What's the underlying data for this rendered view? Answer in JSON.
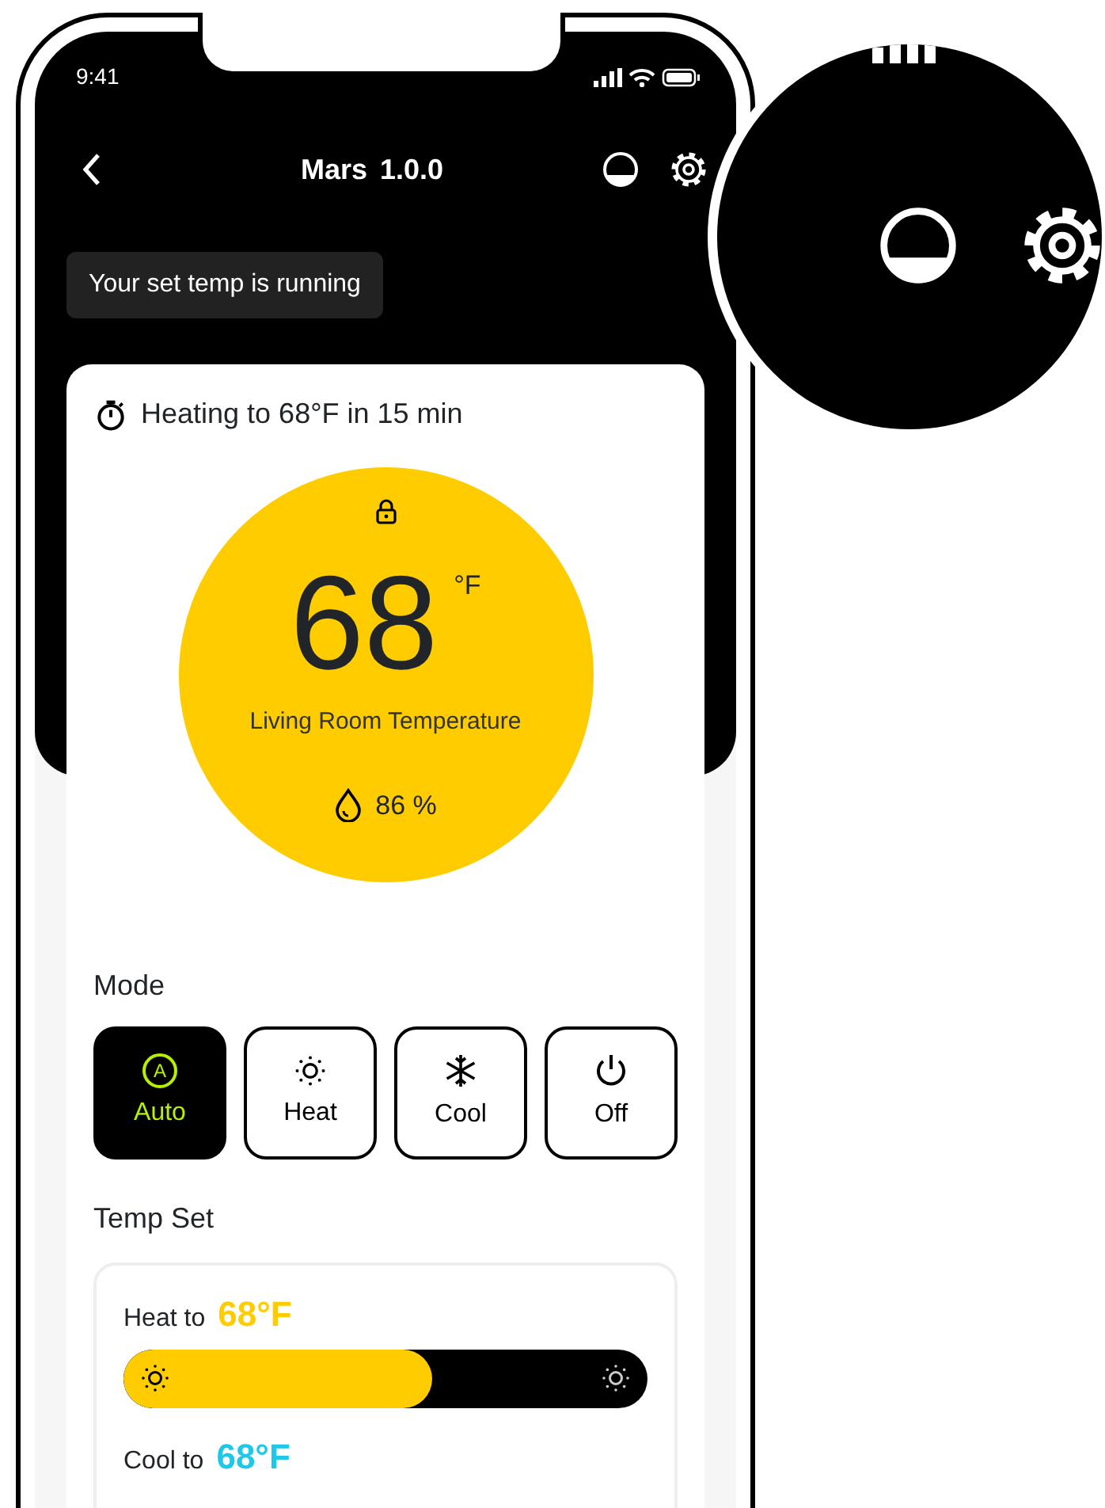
{
  "status_bar": {
    "time": "9:41"
  },
  "nav": {
    "title": "Mars",
    "version": "1.0.0"
  },
  "toast": "Your set temp is running",
  "status_line": "Heating to 68°F in 15 min",
  "dial": {
    "locked": true,
    "temperature": "68",
    "unit": "°F",
    "label": "Living Room Temperature",
    "humidity": "86 %"
  },
  "mode": {
    "title": "Mode",
    "options": [
      {
        "kind": "auto",
        "icon_letter": "A",
        "label": "Auto",
        "selected": true
      },
      {
        "kind": "heat",
        "label": "Heat",
        "selected": false
      },
      {
        "kind": "cool",
        "label": "Cool",
        "selected": false
      },
      {
        "kind": "off",
        "label": "Off",
        "selected": false
      }
    ]
  },
  "temp_set": {
    "title": "Temp Set",
    "rows": [
      {
        "label": "Heat to",
        "value": "68°F",
        "color": "#ffcc00",
        "level": 0.59
      },
      {
        "label": "Cool to",
        "value": "68°F",
        "color": "#1ec8e8"
      }
    ]
  }
}
